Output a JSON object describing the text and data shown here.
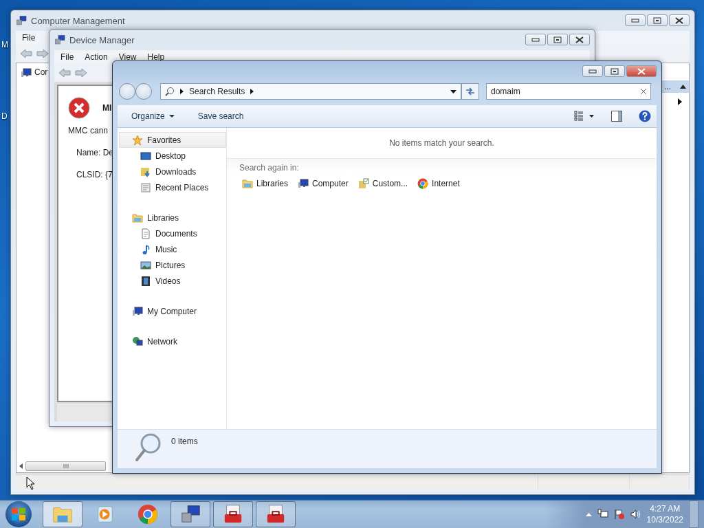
{
  "desktop_icons": [
    {
      "label": "M"
    },
    {
      "label": "D"
    }
  ],
  "computer_management": {
    "title": "Computer Management",
    "menu": [
      "File"
    ],
    "tree": [
      "Cor"
    ],
    "actions_header": "..."
  },
  "device_manager": {
    "title": "Device Manager",
    "menu": [
      "File",
      "Action",
      "View",
      "Help"
    ],
    "error": {
      "heading": "MI",
      "lines": [
        "MMC cann",
        "Name: De",
        "CLSID: {7"
      ]
    }
  },
  "explorer": {
    "breadcrumb": [
      "Search Results"
    ],
    "search": {
      "value": "domaim"
    },
    "toolbar": [
      "Organize",
      "Save search"
    ],
    "nav": [
      {
        "label": "Favorites",
        "kind": "star",
        "selected": true,
        "children": [
          {
            "label": "Desktop",
            "kind": "desktop",
            "selected": false
          },
          {
            "label": "Downloads",
            "kind": "downloads",
            "selected": false
          },
          {
            "label": "Recent Places",
            "kind": "recent",
            "selected": false
          }
        ]
      },
      {
        "label": "Libraries",
        "kind": "library",
        "selected": false,
        "children": [
          {
            "label": "Documents",
            "kind": "document",
            "selected": false
          },
          {
            "label": "Music",
            "kind": "music",
            "selected": false
          },
          {
            "label": "Pictures",
            "kind": "pictures",
            "selected": false
          },
          {
            "label": "Videos",
            "kind": "videos",
            "selected": false
          }
        ]
      },
      {
        "label": "My Computer",
        "kind": "computer",
        "selected": false
      },
      {
        "label": "Network",
        "kind": "network",
        "selected": false
      }
    ],
    "empty_message": "No items match your search.",
    "search_again_label": "Search again in:",
    "search_again": [
      {
        "label": "Libraries",
        "kind": "library"
      },
      {
        "label": "Computer",
        "kind": "computer"
      },
      {
        "label": "Custom...",
        "kind": "custom"
      },
      {
        "label": "Internet",
        "kind": "chrome"
      }
    ],
    "status": "0 items"
  },
  "taskbar": {
    "apps": [
      {
        "kind": "explorer",
        "running": true,
        "selected": true
      },
      {
        "kind": "media",
        "running": false,
        "selected": false
      },
      {
        "kind": "chrome",
        "running": false,
        "selected": false
      },
      {
        "kind": "mmc",
        "running": true,
        "selected": false
      },
      {
        "kind": "toolbox",
        "running": true,
        "selected": false
      },
      {
        "kind": "toolbox",
        "running": true,
        "selected": false
      }
    ],
    "clock": {
      "time": "4:27 AM",
      "date": "10/3/2022"
    }
  }
}
